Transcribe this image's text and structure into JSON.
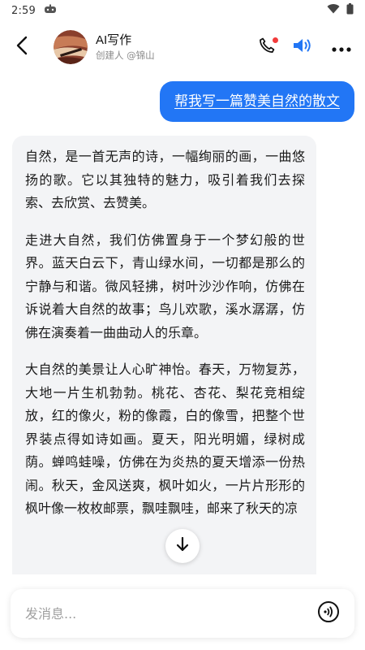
{
  "status_bar": {
    "time": "2:59",
    "left_icon": "gamepad-icon",
    "right_icons": [
      "wifi-icon",
      "battery-icon"
    ]
  },
  "header": {
    "bot_name": "AI写作",
    "creator": "创建人 @锦山",
    "icons": [
      "back-arrow-icon",
      "phone-icon",
      "speaker-icon",
      "more-icon"
    ]
  },
  "chat": {
    "user_message": "帮我写一篇赞美自然的散文",
    "bot_paragraphs": [
      "自然，是一首无声的诗，一幅绚丽的画，一曲悠扬的歌。它以其独特的魅力，吸引着我们去探索、去欣赏、去赞美。",
      "走进大自然，我们仿佛置身于一个梦幻般的世界。蓝天白云下，青山绿水间，一切都是那么的宁静与和谐。微风轻拂，树叶沙沙作响，仿佛在诉说着大自然的故事；鸟儿欢歌，溪水潺潺，仿佛在演奏着一曲曲动人的乐章。",
      "大自然的美景让人心旷神怡。春天，万物复苏，大地一片生机勃勃。桃花、杏花、梨花竞相绽放，红的像火，粉的像霞，白的像雪，把整个世界装点得如诗如画。夏天，阳光明媚，绿树成荫。蝉鸣蛙噪，仿佛在为炎热的夏天增添一份热闹。秋天，金风送爽，枫叶如火，一片片形形的枫叶像一枚枚邮票，飘哇飘哇，邮来了秋天的凉"
    ]
  },
  "input": {
    "placeholder": "发消息...",
    "voice_icon": "voice-icon"
  },
  "colors": {
    "accent": "#2276f5",
    "bot_bubble_bg": "#f3f4f6",
    "badge": "#f23b3b"
  }
}
